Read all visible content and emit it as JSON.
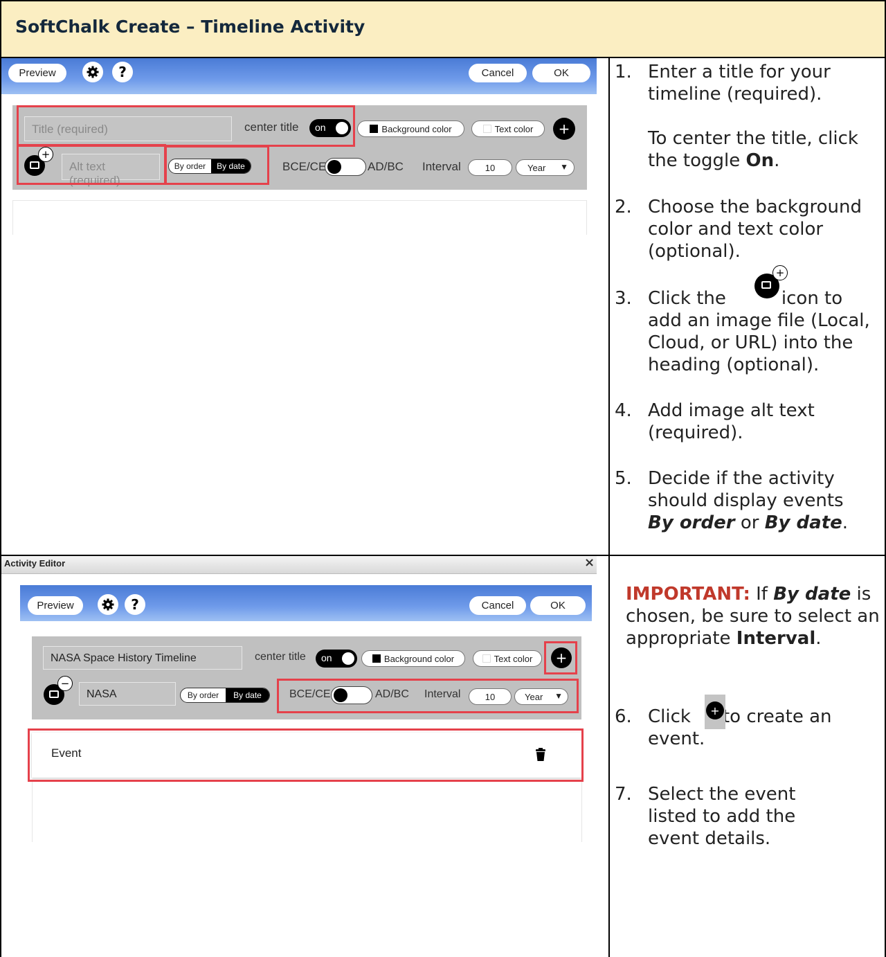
{
  "header": {
    "title": "SoftChalk Create – Timeline Activity"
  },
  "editor1": {
    "preview_label": "Preview",
    "cancel_label": "Cancel",
    "ok_label": "OK",
    "help_label": "?",
    "title_placeholder": "Title (required)",
    "center_title_label": "center title",
    "toggle_on_label": "on",
    "bg_color_label": "Background color",
    "text_color_label": "Text color",
    "alt_placeholder": "Alt text (required)",
    "by_order_label": "By order",
    "by_date_label": "By date",
    "era_left": "BCE/CE",
    "era_right": "AD/BC",
    "interval_label": "Interval",
    "interval_value": "10",
    "interval_unit": "Year"
  },
  "editor2": {
    "window_title": "Activity Editor",
    "close_label": "×",
    "preview_label": "Preview",
    "cancel_label": "Cancel",
    "ok_label": "OK",
    "help_label": "?",
    "title_value": "NASA Space History Timeline",
    "center_title_label": "center title",
    "toggle_on_label": "on",
    "bg_color_label": "Background color",
    "text_color_label": "Text color",
    "alt_value": "NASA",
    "by_order_label": "By order",
    "by_date_label": "By date",
    "era_left": "BCE/CE",
    "era_right": "AD/BC",
    "interval_label": "Interval",
    "interval_value": "10",
    "interval_unit": "Year",
    "event_label": "Event"
  },
  "instructions": {
    "s1_num": "1.",
    "s1_a": "Enter a title for your timeline (required).",
    "s1_b1": "To center the title, click the toggle ",
    "s1_b2": "On",
    "s1_b3": ".",
    "s2_num": "2.",
    "s2": "Choose the background color and text color (optional).",
    "s3_num": "3.",
    "s3_a": "Click the",
    "s3_b": "icon to",
    "s3_c": "add an image file (Local, Cloud, or URL) into the heading (optional).",
    "s4_num": "4.",
    "s4": "Add image alt text (required).",
    "s5_num": "5.",
    "s5_a": "Decide if the activity should display events ",
    "s5_b": "By order",
    "s5_c": " or ",
    "s5_d": "By date",
    "s5_e": ".",
    "imp_label": "IMPORTANT:",
    "imp_a": " If ",
    "imp_b": "By date",
    "imp_c": " is chosen, be sure to select an appropriate ",
    "imp_d": "Interval",
    "imp_e": ".",
    "s6_num": "6.",
    "s6_a": "Click",
    "s6_b": "to create an",
    "s6_c": "event.",
    "s7_num": "7.",
    "s7": "Select the event listed to add the event details."
  }
}
